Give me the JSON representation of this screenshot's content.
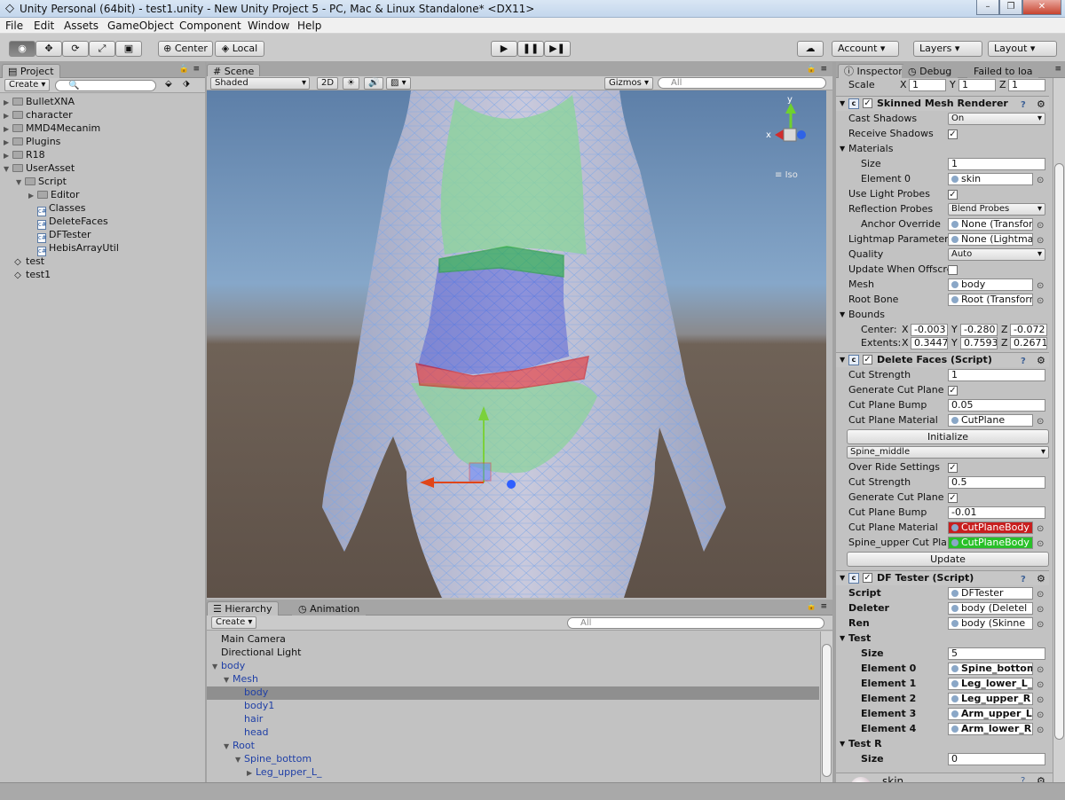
{
  "window": {
    "title": "Unity Personal (64bit) - test1.unity - New Unity Project 5 - PC, Mac & Linux Standalone* <DX11>"
  },
  "menu": [
    "File",
    "Edit",
    "Assets",
    "GameObject",
    "Component",
    "Window",
    "Help"
  ],
  "toolbar": {
    "center": "Center",
    "local": "Local",
    "account": "Account",
    "layers": "Layers",
    "layout": "Layout"
  },
  "project": {
    "tab": "Project",
    "create": "Create",
    "tree": [
      {
        "label": "BulletXNA",
        "kind": "folder",
        "depth": 0
      },
      {
        "label": "character",
        "kind": "folder",
        "depth": 0
      },
      {
        "label": "MMD4Mecanim",
        "kind": "folder",
        "depth": 0
      },
      {
        "label": "Plugins",
        "kind": "folder",
        "depth": 0
      },
      {
        "label": "R18",
        "kind": "folder",
        "depth": 0
      },
      {
        "label": "UserAsset",
        "kind": "folder-open",
        "depth": 0
      },
      {
        "label": "Script",
        "kind": "folder-open",
        "depth": 1
      },
      {
        "label": "Editor",
        "kind": "folder",
        "depth": 2
      },
      {
        "label": "Classes",
        "kind": "script",
        "depth": 2
      },
      {
        "label": "DeleteFaces",
        "kind": "script",
        "depth": 2
      },
      {
        "label": "DFTester",
        "kind": "script",
        "depth": 2
      },
      {
        "label": "HebisArrayUtil",
        "kind": "script",
        "depth": 2
      },
      {
        "label": "test",
        "kind": "unity",
        "depth": 0
      },
      {
        "label": "test1",
        "kind": "unity",
        "depth": 0
      }
    ]
  },
  "scene": {
    "tab": "Scene",
    "shading": "Shaded",
    "mode2d": "2D",
    "gizmos": "Gizmos",
    "search": "All",
    "iso": "Iso",
    "axis_x": "x",
    "axis_y": "y"
  },
  "hierarchy": {
    "tab": "Hierarchy",
    "tab2": "Animation",
    "create": "Create",
    "search": "All",
    "items": [
      {
        "label": "Main Camera",
        "depth": 0,
        "fold": "",
        "blue": false,
        "selected": false
      },
      {
        "label": "Directional Light",
        "depth": 0,
        "fold": "",
        "blue": false,
        "selected": false
      },
      {
        "label": "body",
        "depth": 0,
        "fold": "▼",
        "blue": true,
        "selected": false
      },
      {
        "label": "Mesh",
        "depth": 1,
        "fold": "▼",
        "blue": true,
        "selected": false
      },
      {
        "label": "body",
        "depth": 2,
        "fold": "",
        "blue": true,
        "selected": true
      },
      {
        "label": "body1",
        "depth": 2,
        "fold": "",
        "blue": true,
        "selected": false
      },
      {
        "label": "hair",
        "depth": 2,
        "fold": "",
        "blue": true,
        "selected": false
      },
      {
        "label": "head",
        "depth": 2,
        "fold": "",
        "blue": true,
        "selected": false
      },
      {
        "label": "Root",
        "depth": 1,
        "fold": "▼",
        "blue": true,
        "selected": false
      },
      {
        "label": "Spine_bottom",
        "depth": 2,
        "fold": "▼",
        "blue": true,
        "selected": false
      },
      {
        "label": "Leg_upper_L_",
        "depth": 3,
        "fold": "▶",
        "blue": true,
        "selected": false
      }
    ]
  },
  "inspector": {
    "tabs": [
      "Inspector",
      "Debug",
      "Failed to loa"
    ],
    "scale": {
      "label": "Scale",
      "x": "1",
      "y": "1",
      "z": "1"
    },
    "smr": {
      "title": "Skinned Mesh Renderer",
      "rows": [
        {
          "label": "Cast Shadows",
          "type": "pop",
          "value": "On"
        },
        {
          "label": "Receive Shadows",
          "type": "chk",
          "value": "✓"
        },
        {
          "label": "Materials",
          "type": "fold",
          "value": ""
        },
        {
          "label": "Size",
          "type": "txt",
          "value": "1",
          "indent": true
        },
        {
          "label": "Element 0",
          "type": "obj",
          "value": "skin",
          "indent": true
        },
        {
          "label": "Use Light Probes",
          "type": "chk",
          "value": "✓"
        },
        {
          "label": "Reflection Probes",
          "type": "pop",
          "value": "Blend Probes"
        },
        {
          "label": "Anchor Override",
          "type": "obj",
          "value": "None (Transform)",
          "indent": true
        },
        {
          "label": "Lightmap Parameter",
          "type": "obj",
          "value": "None (Lightmap P"
        },
        {
          "label": "Quality",
          "type": "pop",
          "value": "Auto"
        },
        {
          "label": "Update When Offscre",
          "type": "chk",
          "value": ""
        },
        {
          "label": "Mesh",
          "type": "obj",
          "value": "body"
        },
        {
          "label": "Root Bone",
          "type": "obj",
          "value": "Root (Transforn"
        },
        {
          "label": "Bounds",
          "type": "fold",
          "value": ""
        }
      ],
      "center": {
        "label": "Center:",
        "x": "-0.003",
        "y": "-0.280",
        "z": "-0.072"
      },
      "extents": {
        "label": "Extents:",
        "x": "0.3447",
        "y": "0.7593",
        "z": "0.2671"
      }
    },
    "df": {
      "title": "Delete Faces (Script)",
      "rows": [
        {
          "label": "Cut Strength",
          "type": "txt",
          "value": "1"
        },
        {
          "label": "Generate Cut Plane",
          "type": "chk",
          "value": "✓"
        },
        {
          "label": "Cut Plane Bump",
          "type": "txt",
          "value": "0.05"
        },
        {
          "label": "Cut Plane Material",
          "type": "obj",
          "value": "CutPlane"
        }
      ],
      "initialize": "Initialize",
      "bone": "Spine_middle",
      "rows2": [
        {
          "label": "Over Ride Settings",
          "type": "chk",
          "value": "✓"
        },
        {
          "label": "Cut Strength",
          "type": "txt",
          "value": "0.5"
        },
        {
          "label": "Generate Cut Plane",
          "type": "chk",
          "value": "✓"
        },
        {
          "label": "Cut Plane Bump",
          "type": "txt",
          "value": "-0.01"
        },
        {
          "label": "Cut Plane Material",
          "type": "red",
          "value": "CutPlaneBody"
        },
        {
          "label": "Spine_upper Cut Pla",
          "type": "green",
          "value": "CutPlaneBody"
        }
      ],
      "update": "Update"
    },
    "dft": {
      "title": "DF Tester (Script)",
      "rows": [
        {
          "label": "Script",
          "type": "obj",
          "value": "DFTester",
          "bold": true
        },
        {
          "label": "Deleter",
          "type": "obj",
          "value": "body (Deletel",
          "bold": true
        },
        {
          "label": "Ren",
          "type": "obj",
          "value": "body (Skinne",
          "bold": true
        },
        {
          "label": "Test",
          "type": "fold",
          "value": "",
          "bold": true
        },
        {
          "label": "Size",
          "type": "txt",
          "value": "5",
          "indent": true,
          "bold": true
        },
        {
          "label": "Element 0",
          "type": "bone",
          "value": "Spine_bottom",
          "indent": true,
          "bold": true
        },
        {
          "label": "Element 1",
          "type": "bone",
          "value": "Leg_lower_L_",
          "indent": true,
          "bold": true
        },
        {
          "label": "Element 2",
          "type": "bone",
          "value": "Leg_upper_R",
          "indent": true,
          "bold": true
        },
        {
          "label": "Element 3",
          "type": "bone",
          "value": "Arm_upper_L",
          "indent": true,
          "bold": true
        },
        {
          "label": "Element 4",
          "type": "bone",
          "value": "Arm_lower_R",
          "indent": true,
          "bold": true
        },
        {
          "label": "Test R",
          "type": "fold",
          "value": "",
          "bold": true
        },
        {
          "label": "Size",
          "type": "txt",
          "value": "0",
          "indent": true,
          "bold": true
        }
      ]
    },
    "material": {
      "label": "skin"
    }
  },
  "colors": {
    "accent_selected": "#8f8f8f",
    "hier_blue": "#1f3fa6",
    "red_mat": "#c81e1e",
    "green_mat": "#28c028"
  }
}
